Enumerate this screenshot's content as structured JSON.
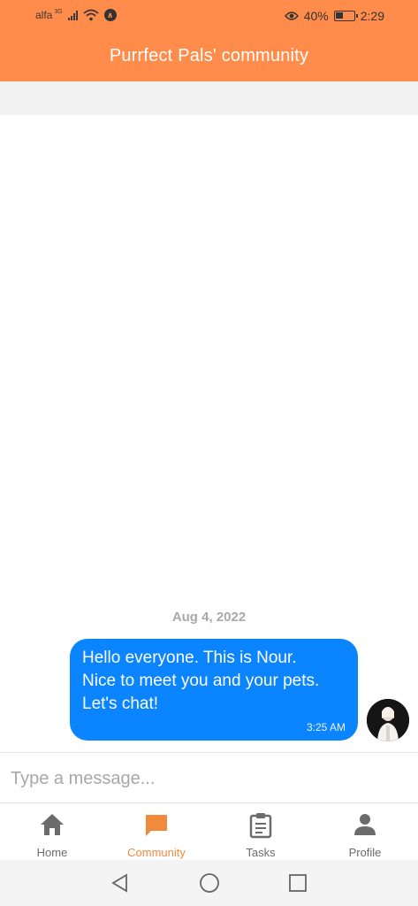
{
  "status_bar": {
    "carrier": "alfa",
    "network": "3G",
    "battery_percent": "40%",
    "time": "2:29",
    "icons": [
      "signal-icon",
      "wifi-icon",
      "nfc-icon",
      "eye-icon",
      "battery-icon"
    ]
  },
  "header": {
    "title": "Purrfect Pals' community",
    "color": "#ff8c4a"
  },
  "chat": {
    "date": "Aug 4, 2022",
    "messages": [
      {
        "text": "Hello everyone. This is Nour.\nNice to meet you and your pets.\nLet's chat!",
        "time": "3:25 AM",
        "bubble_color": "#0a84ff"
      }
    ]
  },
  "composer": {
    "placeholder": "Type a message..."
  },
  "tabs": [
    {
      "label": "Home",
      "icon": "home-icon",
      "active": false
    },
    {
      "label": "Community",
      "icon": "chat-bubble-icon",
      "active": true
    },
    {
      "label": "Tasks",
      "icon": "clipboard-icon",
      "active": false
    },
    {
      "label": "Profile",
      "icon": "person-icon",
      "active": false
    }
  ],
  "theme": {
    "accent": "#f28a3c",
    "inactive": "#6b6b6b"
  }
}
